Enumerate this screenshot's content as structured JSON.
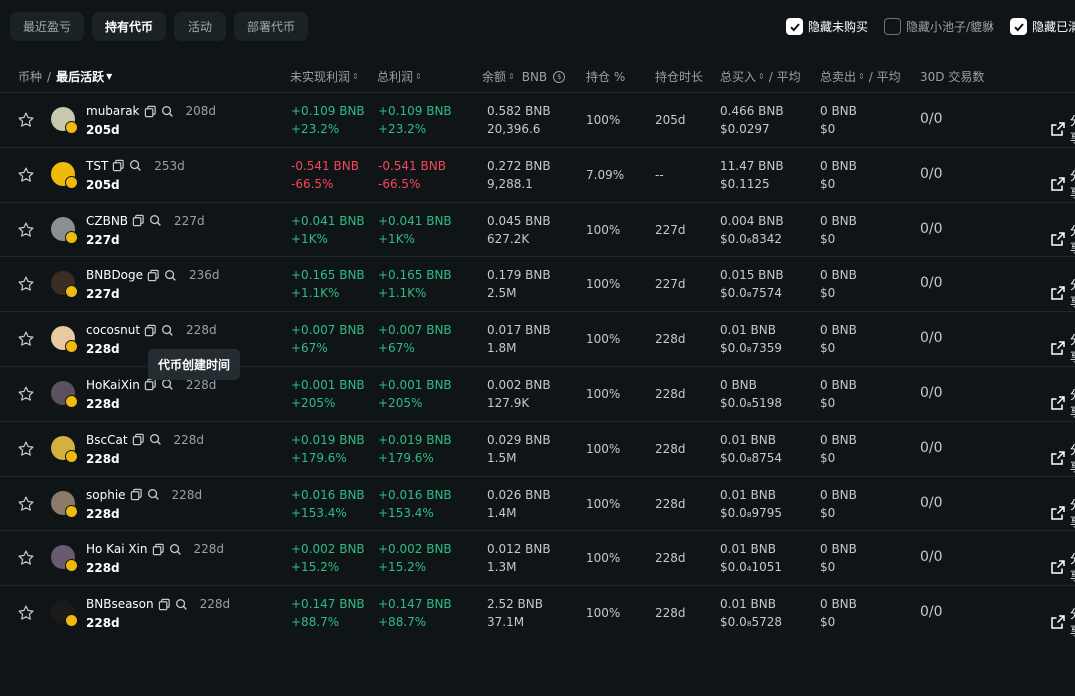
{
  "tabs": [
    {
      "label": "最近盈亏",
      "active": false
    },
    {
      "label": "持有代币",
      "active": true
    },
    {
      "label": "活动",
      "active": false
    },
    {
      "label": "部署代币",
      "active": false
    }
  ],
  "filters": [
    {
      "label": "隐藏未购买",
      "checked": true
    },
    {
      "label": "隐藏小池子/貔貅",
      "checked": false
    },
    {
      "label": "隐藏已清",
      "checked": true
    }
  ],
  "columns": {
    "coin": "币种",
    "slash": "/",
    "last_active": "最后活跃",
    "unrealized": "未实现利润",
    "total_profit": "总利润",
    "balance": "余额",
    "balance_unit": "BNB",
    "holding_pct": "持仓 %",
    "holding_duration": "持仓时长",
    "total_buy": "总买入",
    "total_buy_avg": "/ 平均",
    "total_sell": "总卖出",
    "total_sell_avg": "/ 平均",
    "tx_30d": "30D 交易数"
  },
  "rows": [
    {
      "name": "mubarak",
      "age": "208d",
      "last": "205d",
      "unreal_bnb": "+0.109 BNB",
      "unreal_pct": "+23.2%",
      "total_bnb": "+0.109 BNB",
      "total_pct": "+23.2%",
      "pos": true,
      "bal_bnb": "0.582 BNB",
      "bal_amt": "20,396.6",
      "pct": "100%",
      "dur": "205d",
      "buy_bnb": "0.466 BNB",
      "buy_avg": "$0.0297",
      "sell_bnb": "0 BNB",
      "sell_avg": "$0",
      "tx": "0/0",
      "avatar": "#c9c9b0"
    },
    {
      "name": "TST",
      "age": "253d",
      "last": "205d",
      "unreal_bnb": "-0.541 BNB",
      "unreal_pct": "-66.5%",
      "total_bnb": "-0.541 BNB",
      "total_pct": "-66.5%",
      "pos": false,
      "bal_bnb": "0.272 BNB",
      "bal_amt": "9,288.1",
      "pct": "7.09%",
      "dur": "--",
      "buy_bnb": "11.47 BNB",
      "buy_avg": "$0.1125",
      "sell_bnb": "0 BNB",
      "sell_avg": "$0",
      "tx": "0/0",
      "avatar": "#f0b90b"
    },
    {
      "name": "CZBNB",
      "age": "227d",
      "last": "227d",
      "unreal_bnb": "+0.041 BNB",
      "unreal_pct": "+1K%",
      "total_bnb": "+0.041 BNB",
      "total_pct": "+1K%",
      "pos": true,
      "bal_bnb": "0.045 BNB",
      "bal_amt": "627.2K",
      "pct": "100%",
      "dur": "227d",
      "buy_bnb": "0.004 BNB",
      "buy_avg": "$0.0₆8342",
      "sell_bnb": "0 BNB",
      "sell_avg": "$0",
      "tx": "0/0",
      "avatar": "#8a8f93"
    },
    {
      "name": "BNBDoge",
      "age": "236d",
      "last": "227d",
      "unreal_bnb": "+0.165 BNB",
      "unreal_pct": "+1.1K%",
      "total_bnb": "+0.165 BNB",
      "total_pct": "+1.1K%",
      "pos": true,
      "bal_bnb": "0.179 BNB",
      "bal_amt": "2.5M",
      "pct": "100%",
      "dur": "227d",
      "buy_bnb": "0.015 BNB",
      "buy_avg": "$0.0₈7574",
      "sell_bnb": "0 BNB",
      "sell_avg": "$0",
      "tx": "0/0",
      "avatar": "#3a2e22"
    },
    {
      "name": "cocosnut",
      "age": "228d",
      "last": "228d",
      "unreal_bnb": "+0.007 BNB",
      "unreal_pct": "+67%",
      "total_bnb": "+0.007 BNB",
      "total_pct": "+67%",
      "pos": true,
      "bal_bnb": "0.017 BNB",
      "bal_amt": "1.8M",
      "pct": "100%",
      "dur": "228d",
      "buy_bnb": "0.01 BNB",
      "buy_avg": "$0.0₈7359",
      "sell_bnb": "0 BNB",
      "sell_avg": "$0",
      "tx": "0/0",
      "avatar": "#e8c9a0"
    },
    {
      "name": "HoKaiXin",
      "age": "228d",
      "last": "228d",
      "unreal_bnb": "+0.001 BNB",
      "unreal_pct": "+205%",
      "total_bnb": "+0.001 BNB",
      "total_pct": "+205%",
      "pos": true,
      "bal_bnb": "0.002 BNB",
      "bal_amt": "127.9K",
      "pct": "100%",
      "dur": "228d",
      "buy_bnb": "0 BNB",
      "buy_avg": "$0.0₈5198",
      "sell_bnb": "0 BNB",
      "sell_avg": "$0",
      "tx": "0/0",
      "avatar": "#5a5060"
    },
    {
      "name": "BscCat",
      "age": "228d",
      "last": "228d",
      "unreal_bnb": "+0.019 BNB",
      "unreal_pct": "+179.6%",
      "total_bnb": "+0.019 BNB",
      "total_pct": "+179.6%",
      "pos": true,
      "bal_bnb": "0.029 BNB",
      "bal_amt": "1.5M",
      "pct": "100%",
      "dur": "228d",
      "buy_bnb": "0.01 BNB",
      "buy_avg": "$0.0₈8754",
      "sell_bnb": "0 BNB",
      "sell_avg": "$0",
      "tx": "0/0",
      "avatar": "#d4b040"
    },
    {
      "name": "sophie",
      "age": "228d",
      "last": "228d",
      "unreal_bnb": "+0.016 BNB",
      "unreal_pct": "+153.4%",
      "total_bnb": "+0.016 BNB",
      "total_pct": "+153.4%",
      "pos": true,
      "bal_bnb": "0.026 BNB",
      "bal_amt": "1.4M",
      "pct": "100%",
      "dur": "228d",
      "buy_bnb": "0.01 BNB",
      "buy_avg": "$0.0₈9795",
      "sell_bnb": "0 BNB",
      "sell_avg": "$0",
      "tx": "0/0",
      "avatar": "#8a7a6a"
    },
    {
      "name": "Ho Kai Xin",
      "age": "228d",
      "last": "228d",
      "unreal_bnb": "+0.002 BNB",
      "unreal_pct": "+15.2%",
      "total_bnb": "+0.002 BNB",
      "total_pct": "+15.2%",
      "pos": true,
      "bal_bnb": "0.012 BNB",
      "bal_amt": "1.3M",
      "pct": "100%",
      "dur": "228d",
      "buy_bnb": "0.01 BNB",
      "buy_avg": "$0.0₄1051",
      "sell_bnb": "0 BNB",
      "sell_avg": "$0",
      "tx": "0/0",
      "avatar": "#6a5a70"
    },
    {
      "name": "BNBseason",
      "age": "228d",
      "last": "228d",
      "unreal_bnb": "+0.147 BNB",
      "unreal_pct": "+88.7%",
      "total_bnb": "+0.147 BNB",
      "total_pct": "+88.7%",
      "pos": true,
      "bal_bnb": "2.52 BNB",
      "bal_amt": "37.1M",
      "pct": "100%",
      "dur": "228d",
      "buy_bnb": "0.01 BNB",
      "buy_avg": "$0.0₈5728",
      "sell_bnb": "0 BNB",
      "sell_avg": "$0",
      "tx": "0/0",
      "avatar": "#1a1a1a"
    }
  ],
  "share_label": "分享",
  "tooltip": "代币创建时间",
  "colors": {
    "positive": "#2ebd85",
    "negative": "#f6465d",
    "accent": "#f0b90b"
  }
}
